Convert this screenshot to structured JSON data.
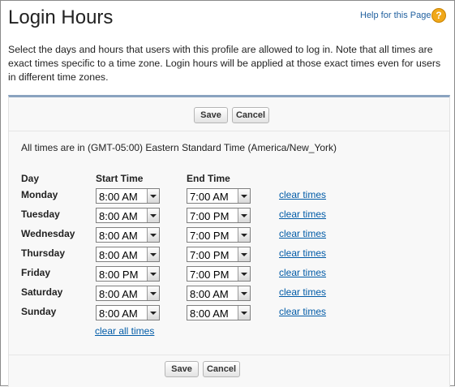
{
  "page": {
    "title": "Login Hours",
    "help_link": "Help for this Page",
    "help_icon": "?",
    "description": "Select the days and hours that users with this profile are allowed to log in. Note that all times are exact times specific to a time zone. Login hours will be applied at those exact times even for users in different time zones."
  },
  "buttons": {
    "save": "Save",
    "cancel": "Cancel"
  },
  "timezone_text": "All times are in (GMT-05:00) Eastern Standard Time (America/New_York)",
  "columns": {
    "day": "Day",
    "start": "Start Time",
    "end": "End Time"
  },
  "days": [
    {
      "day": "Monday",
      "start": "8:00 AM",
      "end": "7:00 AM",
      "clear": "clear times"
    },
    {
      "day": "Tuesday",
      "start": "8:00 AM",
      "end": "7:00 PM",
      "clear": "clear times"
    },
    {
      "day": "Wednesday",
      "start": "8:00 AM",
      "end": "7:00 PM",
      "clear": "clear times"
    },
    {
      "day": "Thursday",
      "start": "8:00 AM",
      "end": "7:00 PM",
      "clear": "clear times"
    },
    {
      "day": "Friday",
      "start": "8:00 PM",
      "end": "7:00 PM",
      "clear": "clear times"
    },
    {
      "day": "Saturday",
      "start": "8:00 AM",
      "end": "8:00 AM",
      "clear": "clear times"
    },
    {
      "day": "Sunday",
      "start": "8:00 AM",
      "end": "8:00 AM",
      "clear": "clear times"
    }
  ],
  "clear_all": "clear all times",
  "colors": {
    "panel_border": "#8aa3bf",
    "link": "#015ba7",
    "help_icon": "#f0a81a"
  }
}
